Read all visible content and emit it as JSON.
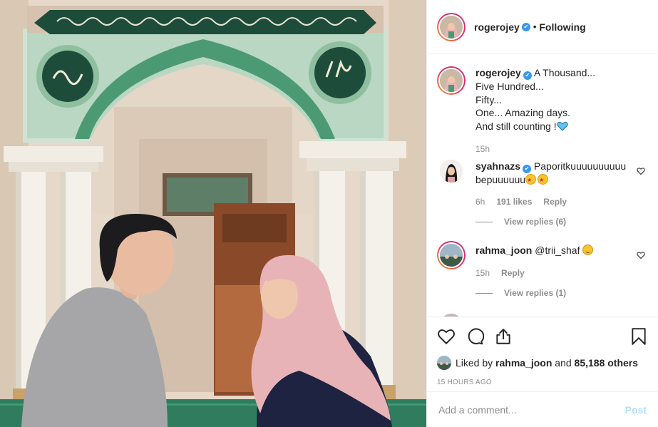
{
  "header": {
    "username": "rogerojey",
    "follow_status": "Following",
    "separator": "•"
  },
  "caption": {
    "username": "rogerojey",
    "lines": [
      "A Thousand...",
      "Five Hundred...",
      "Fifty...",
      "One... Amazing days.",
      "And still counting !"
    ],
    "time": "15h"
  },
  "comments": [
    {
      "username": "syahnazs",
      "text": "Paporitkuuuuuuuuuu bepuuuuuu",
      "time": "6h",
      "likes": "191 likes",
      "reply": "Reply",
      "view_replies": "View replies (6)"
    },
    {
      "username": "rahma_joon",
      "text": "@trii_shaf",
      "time": "15h",
      "reply": "Reply",
      "view_replies": "View replies (1)"
    }
  ],
  "likes": {
    "prefix": "Liked by",
    "user": "rahma_joon",
    "connector": "and",
    "others": "85,188 others"
  },
  "timestamp": "15 HOURS AGO",
  "add_comment": {
    "placeholder": "Add a comment...",
    "post_label": "Post"
  },
  "icons": {
    "verified": "✔",
    "like": "heart-icon",
    "comment": "comment-icon",
    "share": "share-icon",
    "save": "bookmark-icon"
  },
  "colors": {
    "verified_blue": "#3897f0",
    "post_disabled": "#b2dffc",
    "muted": "#8e8e8e"
  }
}
